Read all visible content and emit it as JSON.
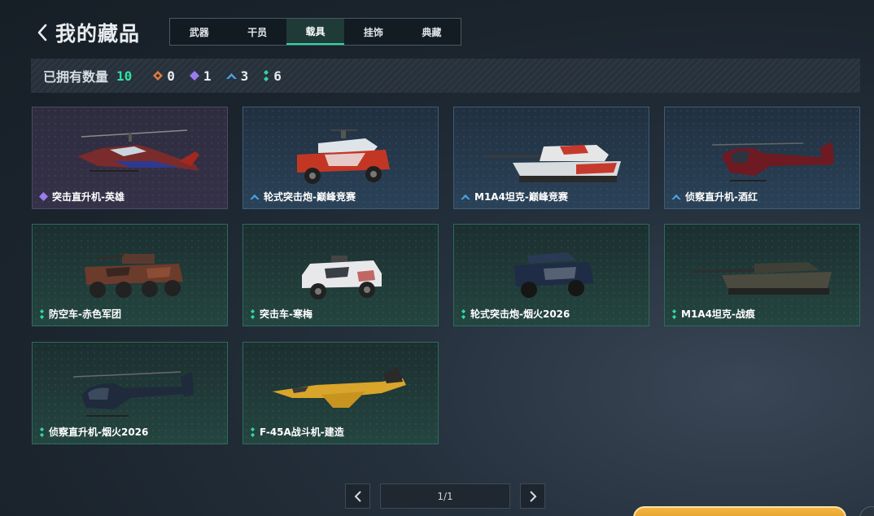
{
  "header": {
    "title": "我的藏品"
  },
  "tabs": [
    {
      "label": "武器",
      "active": false
    },
    {
      "label": "干员",
      "active": false
    },
    {
      "label": "载具",
      "active": true
    },
    {
      "label": "挂饰",
      "active": false
    },
    {
      "label": "典藏",
      "active": false
    }
  ],
  "owned": {
    "label": "已拥有数量",
    "total": "10",
    "rarities": [
      {
        "icon": "orange-diamond-icon",
        "color": "#e07a3f",
        "count": "0"
      },
      {
        "icon": "purple-diamond-icon",
        "color": "#9b7cf0",
        "count": "1"
      },
      {
        "icon": "blue-chevron-icon",
        "color": "#4aa3e8",
        "count": "3"
      },
      {
        "icon": "green-dots-icon",
        "color": "#2dd9a2",
        "count": "6"
      }
    ]
  },
  "items": [
    {
      "name": "突击直升机-英雄",
      "rarity": "purple",
      "icon": "attack-helicopter-icon"
    },
    {
      "name": "轮式突击炮-巅峰竞赛",
      "rarity": "blue",
      "icon": "wheeled-assault-gun-icon"
    },
    {
      "name": "M1A4坦克-巅峰竞赛",
      "rarity": "blue",
      "icon": "tank-icon"
    },
    {
      "name": "侦察直升机-酒红",
      "rarity": "blue",
      "icon": "scout-helicopter-icon"
    },
    {
      "name": "防空车-赤色军团",
      "rarity": "green",
      "icon": "anti-air-vehicle-icon"
    },
    {
      "name": "突击车-寒梅",
      "rarity": "green",
      "icon": "assault-vehicle-icon"
    },
    {
      "name": "轮式突击炮-烟火2026",
      "rarity": "green",
      "icon": "wheeled-assault-gun-icon"
    },
    {
      "name": "M1A4坦克-战痕",
      "rarity": "green",
      "icon": "tank-icon"
    },
    {
      "name": "侦察直升机-烟火2026",
      "rarity": "green",
      "icon": "scout-helicopter-icon"
    },
    {
      "name": "F-45A战斗机-建造",
      "rarity": "green",
      "icon": "fighter-jet-icon"
    }
  ],
  "pager": {
    "label": "1/1"
  }
}
